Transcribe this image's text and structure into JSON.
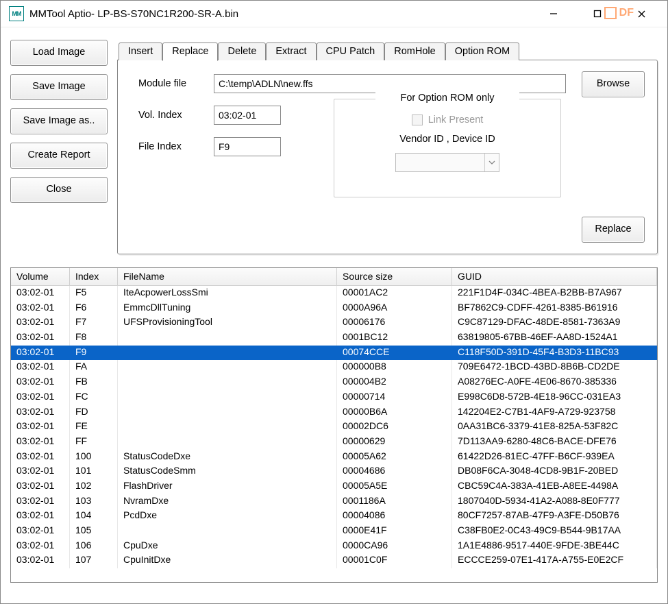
{
  "window": {
    "title": "MMTool Aptio- LP-BS-S70NC1R200-SR-A.bin",
    "icon_text": "MM"
  },
  "sidebar": {
    "load": "Load Image",
    "save": "Save Image",
    "save_as": "Save Image as..",
    "create_report": "Create Report",
    "close": "Close"
  },
  "tabs": {
    "insert": "Insert",
    "replace": "Replace",
    "delete": "Delete",
    "extract": "Extract",
    "cpu_patch": "CPU Patch",
    "rom_hole": "RomHole",
    "option_rom": "Option ROM",
    "active": "replace"
  },
  "form": {
    "module_file_label": "Module file",
    "module_file_value": "C:\\temp\\ADLN\\new.ffs",
    "vol_index_label": "Vol. Index",
    "vol_index_value": "03:02-01",
    "file_index_label": "File Index",
    "file_index_value": "F9",
    "browse": "Browse",
    "replace": "Replace",
    "option_rom_group_label": "For Option ROM only",
    "link_present_label": "Link Present",
    "vendor_device_label": "Vendor ID , Device ID"
  },
  "grid": {
    "columns": {
      "volume": "Volume",
      "index": "Index",
      "filename": "FileName",
      "source_size": "Source size",
      "guid": "GUID"
    },
    "selected_index": 4,
    "rows": [
      {
        "volume": "03:02-01",
        "index": "F5",
        "filename": "IteAcpowerLossSmi",
        "size": "00001AC2",
        "guid": "221F1D4F-034C-4BEA-B2BB-B7A967"
      },
      {
        "volume": "03:02-01",
        "index": "F6",
        "filename": "EmmcDllTuning",
        "size": "0000A96A",
        "guid": "BF7862C9-CDFF-4261-8385-B61916"
      },
      {
        "volume": "03:02-01",
        "index": "F7",
        "filename": "UFSProvisioningTool",
        "size": "00006176",
        "guid": "C9C87129-DFAC-48DE-8581-7363A9"
      },
      {
        "volume": "03:02-01",
        "index": "F8",
        "filename": "",
        "size": "0001BC12",
        "guid": "63819805-67BB-46EF-AA8D-1524A1"
      },
      {
        "volume": "03:02-01",
        "index": "F9",
        "filename": "",
        "size": "00074CCE",
        "guid": "C118F50D-391D-45F4-B3D3-11BC93"
      },
      {
        "volume": "03:02-01",
        "index": "FA",
        "filename": "",
        "size": "000000B8",
        "guid": "709E6472-1BCD-43BD-8B6B-CD2DE"
      },
      {
        "volume": "03:02-01",
        "index": "FB",
        "filename": "",
        "size": "000004B2",
        "guid": "A08276EC-A0FE-4E06-8670-385336"
      },
      {
        "volume": "03:02-01",
        "index": "FC",
        "filename": "",
        "size": "00000714",
        "guid": "E998C6D8-572B-4E18-96CC-031EA3"
      },
      {
        "volume": "03:02-01",
        "index": "FD",
        "filename": "",
        "size": "00000B6A",
        "guid": "142204E2-C7B1-4AF9-A729-923758"
      },
      {
        "volume": "03:02-01",
        "index": "FE",
        "filename": "",
        "size": "00002DC6",
        "guid": "0AA31BC6-3379-41E8-825A-53F82C"
      },
      {
        "volume": "03:02-01",
        "index": "FF",
        "filename": "",
        "size": "00000629",
        "guid": "7D113AA9-6280-48C6-BACE-DFE76"
      },
      {
        "volume": "03:02-01",
        "index": "100",
        "filename": "StatusCodeDxe",
        "size": "00005A62",
        "guid": "61422D26-81EC-47FF-B6CF-939EA"
      },
      {
        "volume": "03:02-01",
        "index": "101",
        "filename": "StatusCodeSmm",
        "size": "00004686",
        "guid": "DB08F6CA-3048-4CD8-9B1F-20BED"
      },
      {
        "volume": "03:02-01",
        "index": "102",
        "filename": "FlashDriver",
        "size": "00005A5E",
        "guid": "CBC59C4A-383A-41EB-A8EE-4498A"
      },
      {
        "volume": "03:02-01",
        "index": "103",
        "filename": "NvramDxe",
        "size": "0001186A",
        "guid": "1807040D-5934-41A2-A088-8E0F777"
      },
      {
        "volume": "03:02-01",
        "index": "104",
        "filename": "PcdDxe",
        "size": "00004086",
        "guid": "80CF7257-87AB-47F9-A3FE-D50B76"
      },
      {
        "volume": "03:02-01",
        "index": "105",
        "filename": "",
        "size": "0000E41F",
        "guid": "C38FB0E2-0C43-49C9-B544-9B17AA"
      },
      {
        "volume": "03:02-01",
        "index": "106",
        "filename": "CpuDxe",
        "size": "0000CA96",
        "guid": "1A1E4886-9517-440E-9FDE-3BE44C"
      },
      {
        "volume": "03:02-01",
        "index": "107",
        "filename": "CpuInitDxe",
        "size": "00001C0F",
        "guid": "ECCCE259-07E1-417A-A755-E0E2CF"
      }
    ]
  },
  "watermark": "DF"
}
